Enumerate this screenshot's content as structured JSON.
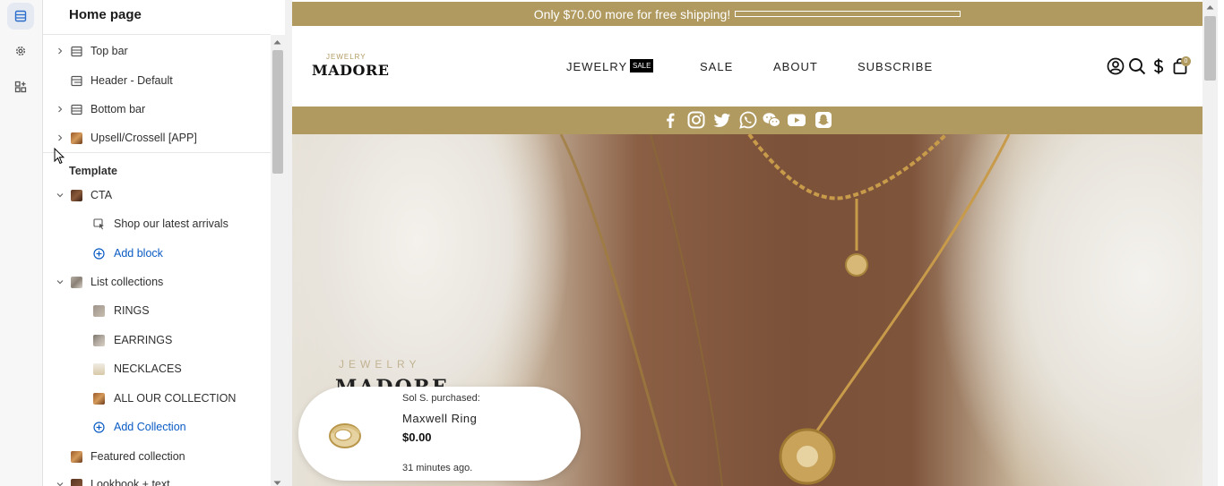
{
  "panel": {
    "title": "Home page",
    "header_items": [
      "Top bar",
      "Header - Default",
      "Bottom bar",
      "Upsell/Crossell [APP]"
    ],
    "template_title": "Template",
    "cta": {
      "label": "CTA",
      "block": "Shop our latest arrivals",
      "add_block": "Add block"
    },
    "list_collections": {
      "label": "List collections",
      "items": [
        "RINGS",
        "EARRINGS",
        "NECKLACES",
        "ALL OUR COLLECTION"
      ],
      "add": "Add Collection"
    },
    "featured": "Featured collection",
    "lookbook": "Lookbook + text"
  },
  "store": {
    "announcement": "Only $70.00 more for free shipping!",
    "free_shipping_progress": 0,
    "logo_top": "JEWELRY",
    "logo_main": "MADORE",
    "nav": [
      "JEWELRY",
      "SALE",
      "ABOUT",
      "SUBSCRIBE"
    ],
    "sale_badge": "SALE",
    "cart_count": "0",
    "social_icons": [
      "facebook-icon",
      "instagram-icon",
      "twitter-icon",
      "whatsapp-icon",
      "wechat-icon",
      "youtube-icon",
      "snapchat-icon"
    ],
    "hero_small": "JEWELRY",
    "hero_big": "MADORE",
    "popup": {
      "line1": "Sol S. purchased:",
      "product": "Maxwell Ring",
      "price": "$0.00",
      "time": "31 minutes ago."
    }
  },
  "colors": {
    "accent": "#b09a60",
    "link": "#0a5bc4"
  }
}
